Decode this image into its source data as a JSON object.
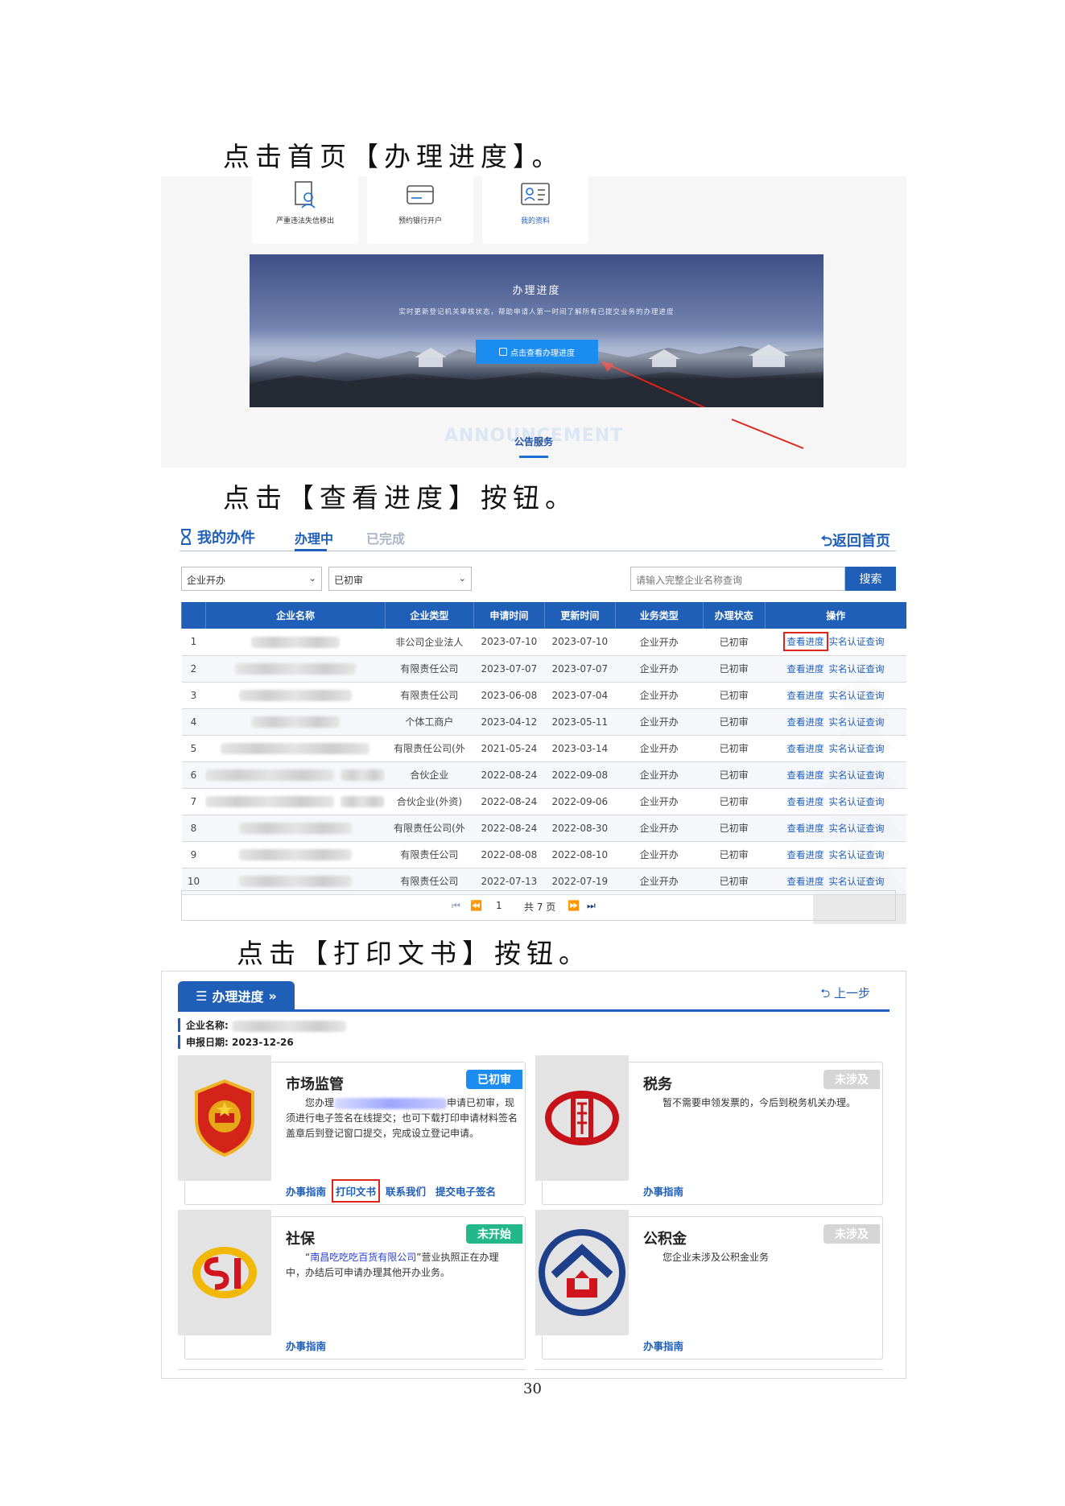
{
  "steps": {
    "step1": "点击首页【办理进度】。",
    "step2": "点击【查看进度】按钮。",
    "step3": "点击【打印文书】按钮。"
  },
  "portal": {
    "tiles": [
      {
        "label": "严重违法失信移出",
        "icon": "person-doc-icon"
      },
      {
        "label": "预约银行开户",
        "icon": "card-icon"
      },
      {
        "label": "我的资料",
        "icon": "profile-icon"
      }
    ],
    "banner": {
      "title": "办理进度",
      "subtitle": "实时更新登记机关审核状态，帮助申请人第一时间了解所有已提交业务的办理进度",
      "button": "点击查看办理进度"
    },
    "announcement_en": "ANNOUNCEMENT",
    "announcement": "公告服务"
  },
  "cases": {
    "title": "我的办件",
    "tabs": [
      "办理中",
      "已完成"
    ],
    "back": "返回首页",
    "filter_type": "企业开办",
    "filter_status": "已初审",
    "search_placeholder": "请输入完整企业名称查询",
    "search_button": "搜索",
    "columns": [
      "企业名称",
      "企业类型",
      "申请时间",
      "更新时间",
      "业务类型",
      "办理状态",
      "操作"
    ],
    "op_view": "查看进度",
    "op_realname": "实名认证查询",
    "rows": [
      {
        "no": "1",
        "type": "非公司企业法人",
        "applied": "2023-07-10",
        "updated": "2023-07-10",
        "biz": "企业开办",
        "status": "已初审"
      },
      {
        "no": "2",
        "type": "有限责任公司",
        "applied": "2023-07-07",
        "updated": "2023-07-07",
        "biz": "企业开办",
        "status": "已初审"
      },
      {
        "no": "3",
        "type": "有限责任公司",
        "applied": "2023-06-08",
        "updated": "2023-07-04",
        "biz": "企业开办",
        "status": "已初审"
      },
      {
        "no": "4",
        "type": "个体工商户",
        "applied": "2023-04-12",
        "updated": "2023-05-11",
        "biz": "企业开办",
        "status": "已初审"
      },
      {
        "no": "5",
        "type": "有限责任公司(外",
        "applied": "2021-05-24",
        "updated": "2023-03-14",
        "biz": "企业开办",
        "status": "已初审"
      },
      {
        "no": "6",
        "type": "合伙企业",
        "applied": "2022-08-24",
        "updated": "2022-09-08",
        "biz": "企业开办",
        "status": "已初审"
      },
      {
        "no": "7",
        "type": "合伙企业(外资)",
        "applied": "2022-08-24",
        "updated": "2022-09-06",
        "biz": "企业开办",
        "status": "已初审"
      },
      {
        "no": "8",
        "type": "有限责任公司(外",
        "applied": "2022-08-24",
        "updated": "2022-08-30",
        "biz": "企业开办",
        "status": "已初审"
      },
      {
        "no": "9",
        "type": "有限责任公司",
        "applied": "2022-08-08",
        "updated": "2022-08-10",
        "biz": "企业开办",
        "status": "已初审"
      },
      {
        "no": "10",
        "type": "有限责任公司",
        "applied": "2022-07-13",
        "updated": "2022-07-19",
        "biz": "企业开办",
        "status": "已初审"
      }
    ],
    "page_current": "1",
    "page_total": "共 7 页"
  },
  "progress": {
    "tab": "办理进度",
    "prev": "上一步",
    "company_label": "企业名称:",
    "date_label": "申报日期:",
    "date": "2023-12-26",
    "cards": [
      {
        "title": "市场监管",
        "badge": "已初审",
        "badge_color": "#1b8df0",
        "text_pre": "您办理",
        "text_post": "申请已初审，现须进行电子签名在线提交；也可下载打印申请材料签名盖章后到登记窗口提交，完成设立登记申请。",
        "links": [
          "办事指南",
          "打印文书",
          "联系我们",
          "提交电子签名"
        ]
      },
      {
        "title": "税务",
        "badge": "未涉及",
        "badge_color": "#d5d5d5",
        "text": "暂不需要申领发票的，今后到税务机关办理。",
        "links": [
          "办事指南"
        ]
      },
      {
        "title": "社保",
        "badge": "未开始",
        "badge_color": "#23b88a",
        "company": "南昌吃吃吃百货有限公司",
        "text_post": "营业执照正在办理中，办结后可申请办理其他开办业务。",
        "links": [
          "办事指南"
        ]
      },
      {
        "title": "公积金",
        "badge": "未涉及",
        "badge_color": "#d5d5d5",
        "text": "您企业未涉及公积金业务",
        "links": [
          "办事指南"
        ]
      }
    ]
  },
  "page_number": "30"
}
